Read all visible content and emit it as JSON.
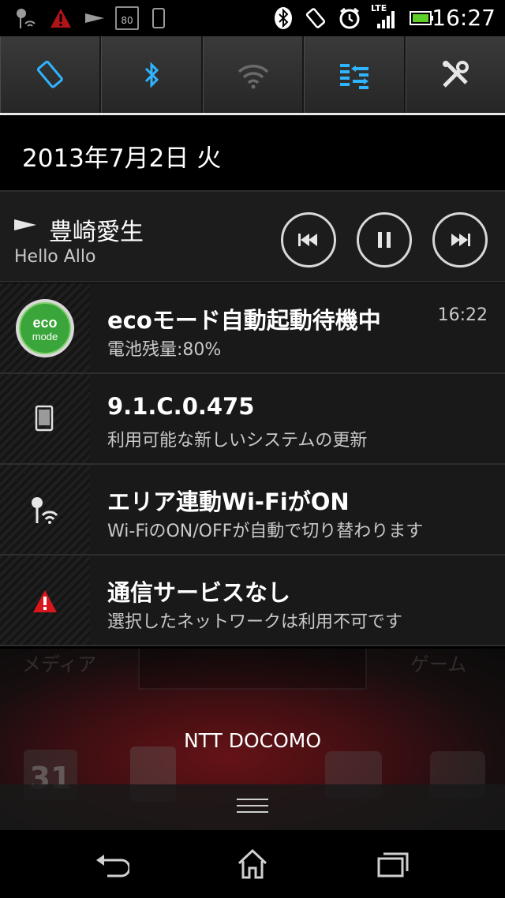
{
  "status_bar": {
    "time": "16:27",
    "network_label": "LTE",
    "left_icons": [
      "location-wifi-icon",
      "warning-icon",
      "play-icon",
      "battery-80-icon",
      "device-icon"
    ],
    "right_icons": [
      "bluetooth-icon",
      "rotation-icon",
      "alarm-icon",
      "signal-icon",
      "battery-icon"
    ],
    "battery_badge": "80"
  },
  "quick_settings": [
    {
      "name": "auto-rotate",
      "icon": "rotation-icon",
      "active": true
    },
    {
      "name": "bluetooth",
      "icon": "bluetooth-icon",
      "active": true
    },
    {
      "name": "wifi",
      "icon": "wifi-icon",
      "active": false
    },
    {
      "name": "data-sync",
      "icon": "sync-arrows-icon",
      "active": true
    },
    {
      "name": "settings",
      "icon": "tools-icon",
      "active": false
    }
  ],
  "date": "2013年7月2日 火",
  "music": {
    "title": "豊崎愛生",
    "artist": "Hello Allo"
  },
  "notifications": [
    {
      "title": "ecoモード自動起動待機中",
      "text": "電池残量:80%",
      "time": "16:22",
      "icon": "eco-mode-icon",
      "icon_label": "eco\nmode"
    },
    {
      "title": "9.1.C.0.475",
      "text": "利用可能な新しいシステムの更新",
      "time": "",
      "icon": "device-update-icon"
    },
    {
      "title": "エリア連動Wi-FiがON",
      "text": "Wi-FiのON/OFFが自動で切り替わります",
      "time": "",
      "icon": "location-wifi-icon"
    },
    {
      "title": "通信サービスなし",
      "text": "選択したネットワークは利用不可です",
      "time": "",
      "icon": "warning-icon"
    }
  ],
  "home_peek": {
    "carrier": "NTT DOCOMO",
    "ghost_left": "メディア",
    "ghost_right": "ゲーム",
    "calendar_number": "31"
  },
  "colors": {
    "accent": "#2fb4ff",
    "warning": "#d8161c",
    "eco_green": "#3aa53a"
  }
}
